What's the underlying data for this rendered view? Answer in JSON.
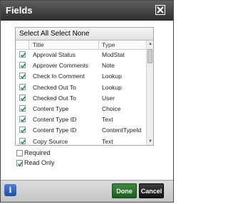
{
  "dialog": {
    "title": "Fields"
  },
  "selection_bar": {
    "select_all": "Select All",
    "select_none": "Select None"
  },
  "columns": {
    "title": "Title",
    "type": "Type"
  },
  "fields": [
    {
      "title": "Approval Status",
      "type": "ModStat",
      "checked": true
    },
    {
      "title": "Approver Comments",
      "type": "Note",
      "checked": true
    },
    {
      "title": "Check In Comment",
      "type": "Lookup",
      "checked": true
    },
    {
      "title": "Checked Out To",
      "type": "Lookup",
      "checked": true
    },
    {
      "title": "Checked Out To",
      "type": "User",
      "checked": true
    },
    {
      "title": "Content Type",
      "type": "Choice",
      "checked": true
    },
    {
      "title": "Content Type ID",
      "type": "Text",
      "checked": true
    },
    {
      "title": "Content Type ID",
      "type": "ContentTypeId",
      "checked": true
    },
    {
      "title": "Copy Source",
      "type": "Text",
      "checked": true
    }
  ],
  "options": {
    "required": {
      "label": "Required",
      "checked": false
    },
    "read_only": {
      "label": "Read Only",
      "checked": true
    }
  },
  "footer": {
    "info_glyph": "i",
    "done_label": "Done",
    "cancel_label": "Cancel"
  },
  "colors": {
    "checkmark": "#2a8a2a",
    "done": "#2d6f2d",
    "titlebar": "#3a3a3a"
  }
}
